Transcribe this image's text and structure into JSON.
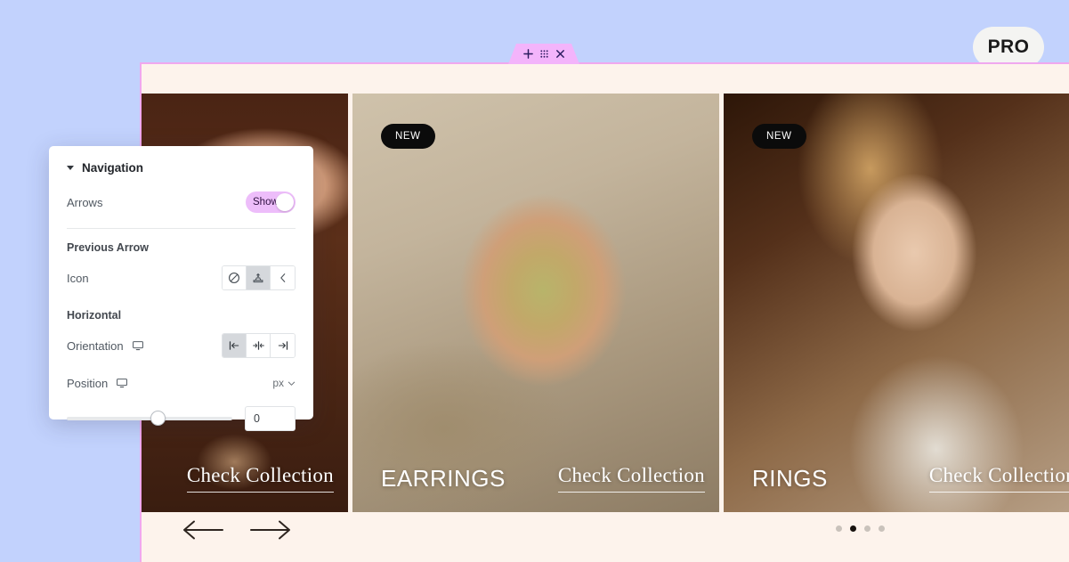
{
  "page": {
    "background_color": "#c2d2fd",
    "pro_badge": "PRO"
  },
  "canvas": {
    "background_color": "#fdf3ec",
    "border_color": "#f0a8ef"
  },
  "handle_tab": {
    "add_icon": "plus-icon",
    "drag_icon": "grid-dots-icon",
    "close_icon": "close-icon",
    "add_glyph": "✛",
    "drag_glyph": "⠿",
    "close_glyph": "✕"
  },
  "carousel": {
    "slides": [
      {
        "badge": "",
        "title": "",
        "cta": "Check Collection"
      },
      {
        "badge": "NEW",
        "title": "EARRINGS",
        "cta": "Check Collection"
      },
      {
        "badge": "NEW",
        "title": "RINGS",
        "cta": "Check Collection"
      },
      {
        "badge": "",
        "title": "",
        "cta": ""
      }
    ],
    "prev_arrow_icon": "arrow-left-icon",
    "next_arrow_icon": "arrow-right-icon",
    "dots": [
      {
        "active": false
      },
      {
        "active": true
      },
      {
        "active": false
      },
      {
        "active": false
      }
    ]
  },
  "panel": {
    "title": "Navigation",
    "collapse_icon": "caret-down-icon",
    "arrows": {
      "label": "Arrows",
      "toggle_value": "Show",
      "toggle_on": true
    },
    "previous_arrow": {
      "section_label": "Previous Arrow",
      "icon_label": "Icon",
      "options": [
        {
          "name": "none-icon",
          "glyph": "⊘",
          "selected": false
        },
        {
          "name": "media-upload-icon",
          "glyph": "⎙",
          "selected": true
        },
        {
          "name": "chevron-left-icon",
          "glyph": "‹",
          "selected": false
        }
      ]
    },
    "horizontal": {
      "section_label": "Horizontal",
      "orientation_label": "Orientation",
      "device_icon": "desktop-icon",
      "options": [
        {
          "name": "align-start-icon",
          "selected": true
        },
        {
          "name": "align-center-icon",
          "selected": false
        },
        {
          "name": "align-end-icon",
          "selected": false
        }
      ],
      "position_label": "Position",
      "position_device_icon": "desktop-icon",
      "unit": "px",
      "unit_caret_icon": "chevron-down-icon",
      "value": "0"
    }
  }
}
